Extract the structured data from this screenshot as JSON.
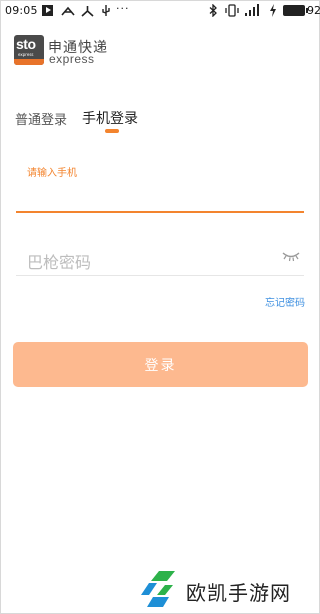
{
  "status_bar": {
    "time": "09:05",
    "battery": "92",
    "icons": [
      "play-icon",
      "network-icon",
      "share-icon",
      "usb-icon",
      "more-dots-icon",
      "bluetooth-icon",
      "vibrate-icon",
      "signal-icon",
      "charging-icon",
      "battery-icon"
    ]
  },
  "brand": {
    "logo_text": "sto",
    "logo_small": "express",
    "name_cn": "申通快递",
    "name_en": "express",
    "accent_color": "#f3842e"
  },
  "tabs": [
    {
      "label": "普通登录",
      "active": false
    },
    {
      "label": "手机登录",
      "active": true
    }
  ],
  "form": {
    "phone_label": "请输入手机",
    "phone_value": "",
    "password_placeholder": "巴枪密码",
    "password_value": "",
    "forgot_label": "忘记密码",
    "login_label": "登录",
    "button_color": "#fdb98f",
    "link_color": "#3d8fe0"
  },
  "watermark": {
    "text": "欧凯手游网"
  }
}
